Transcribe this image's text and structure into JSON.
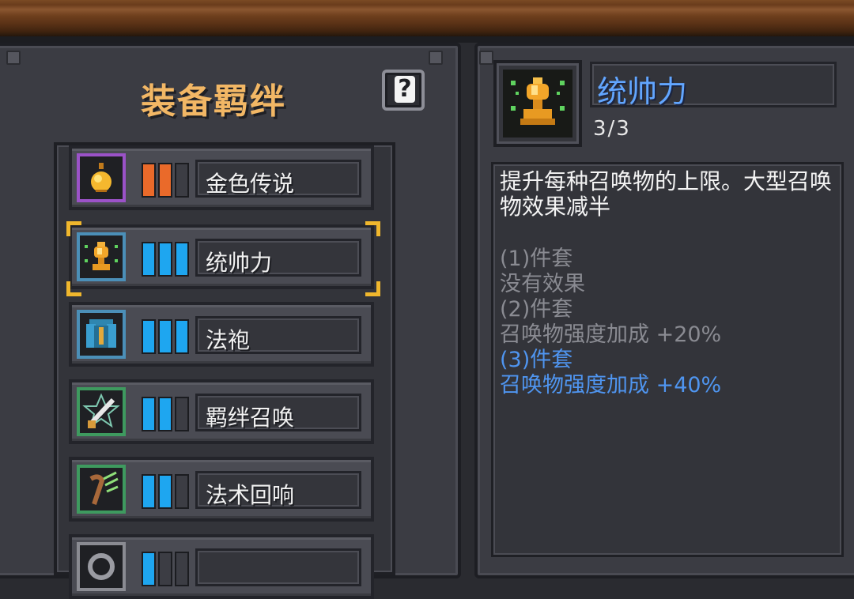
{
  "panel_title": "装备羁绊",
  "help_label": "?",
  "bonds": [
    {
      "name": "金色传说",
      "icon": "golden-drop-icon",
      "frame_color": "#9b52c8",
      "bar_color": "#ea6a2a",
      "level": "2/3"
    },
    {
      "name": "统帅力",
      "icon": "golden-trophy-icon",
      "frame_color": "#4b8fb8",
      "bar_color": "#1ea6f0",
      "level": "3/3",
      "selected": true
    },
    {
      "name": "法袍",
      "icon": "robe-icon",
      "frame_color": "#4b8fb8",
      "bar_color": "#1ea6f0",
      "level": "3/3"
    },
    {
      "name": "羁绊召唤",
      "icon": "summon-sword-icon",
      "frame_color": "#3e9a5f",
      "bar_color": "#1ea6f0",
      "level": "2/3"
    },
    {
      "name": "法术回响",
      "icon": "staff-icon",
      "frame_color": "#3e9a5f",
      "bar_color": "#1ea6f0",
      "level": "2/3"
    },
    {
      "name": "",
      "icon": "gear-icon",
      "frame_color": "#8a8b92",
      "bar_color": "#1ea6f0",
      "level": "1/3"
    }
  ],
  "detail": {
    "name": "统帅力",
    "count": "3/3",
    "icon": "golden-trophy-icon",
    "description": "提升每种召唤物的上限。大型召唤物效果减半",
    "tiers": [
      {
        "label": "(1)件套",
        "effect": "没有效果",
        "active": false
      },
      {
        "label": "(2)件套",
        "effect": "召唤物强度加成 +20%",
        "active": false
      },
      {
        "label": "(3)件套",
        "effect": "召唤物强度加成 +40%",
        "active": true
      }
    ]
  },
  "colors": {
    "title": "#f2b765",
    "active_tier": "#4f95f0",
    "inactive_tier": "#8a8b92",
    "selection": "#f0b72d"
  }
}
